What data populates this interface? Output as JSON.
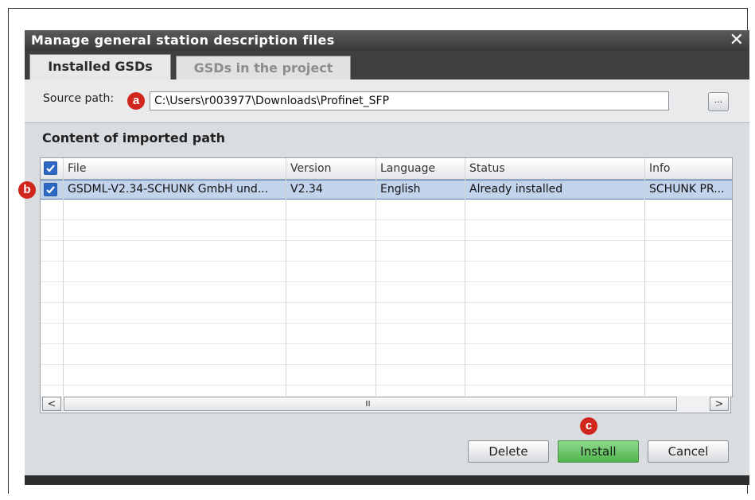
{
  "dialog": {
    "title": "Manage general station description files",
    "close_icon": "close-icon"
  },
  "tabs": [
    {
      "label": "Installed GSDs",
      "active": true
    },
    {
      "label": "GSDs in the project",
      "active": false
    }
  ],
  "source": {
    "label": "Source path:",
    "value": "C:\\Users\\r003977\\Downloads\\Profinet_SFP",
    "browse_label": "..."
  },
  "content": {
    "heading": "Content of imported path",
    "columns": [
      "File",
      "Version",
      "Language",
      "Status",
      "Info"
    ],
    "rows": [
      {
        "checked": true,
        "file": "GSDML-V2.34-SCHUNK GmbH und...",
        "version": "V2.34",
        "language": "English",
        "status": "Already installed",
        "info": "SCHUNK PR..."
      }
    ]
  },
  "scrollbar": {
    "left_icon": "chevron-left-icon",
    "right_icon": "chevron-right-icon",
    "grip": "III"
  },
  "buttons": {
    "delete": "Delete",
    "install": "Install",
    "cancel": "Cancel"
  },
  "markers": {
    "a": "a",
    "b": "b",
    "c": "c"
  },
  "colors": {
    "install_green": "#4fb54d",
    "marker_red": "#d0261d",
    "selection_blue": "#c2d3ec",
    "checkbox_blue": "#2c68c4"
  }
}
